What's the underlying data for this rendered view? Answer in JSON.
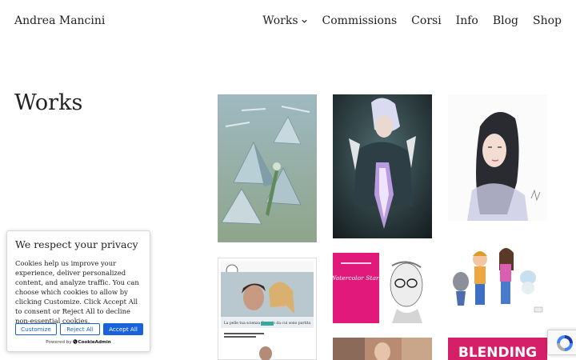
{
  "header": {
    "site_title": "Andrea Mancini",
    "nav": [
      {
        "label": "Works",
        "has_dropdown": true
      },
      {
        "label": "Commissions"
      },
      {
        "label": "Corsi"
      },
      {
        "label": "Info"
      },
      {
        "label": "Blog"
      },
      {
        "label": "Shop"
      }
    ]
  },
  "main": {
    "title": "Works",
    "artworks": [
      {
        "name": "futuristic-pyramid-city-illustration",
        "caption_text": ""
      },
      {
        "name": "anime-character-crystal-illustration"
      },
      {
        "name": "watercolor-woman-portrait"
      },
      {
        "name": "romance-book-cover",
        "caption_text": "La pelle tua scienza il punto da cui sono partita"
      },
      {
        "name": "watercolor-stars-book-cover",
        "caption_text": "Watercolor Stars"
      },
      {
        "name": "cartoon-characters-illustration"
      },
      {
        "name": "painting-thumbnail"
      },
      {
        "name": "blending-book-cover",
        "caption_text": "BLENDING"
      }
    ]
  },
  "cookie_banner": {
    "title": "We respect your privacy",
    "text": "Cookies help us improve your experience, deliver personalized content, and analyze traffic. You can choose which cookies to allow by clicking Customize. Click Accept All to consent or Reject All to decline non-essential cookies.",
    "customize_label": "Customize",
    "reject_label": "Reject All",
    "accept_label": "Accept All",
    "powered_prefix": "Powered by",
    "powered_brand": "CookieAdmin",
    "accent_color": "#1863dc"
  },
  "icons": {
    "works_dropdown": "chevron-down-icon",
    "recaptcha": "recaptcha-icon"
  }
}
